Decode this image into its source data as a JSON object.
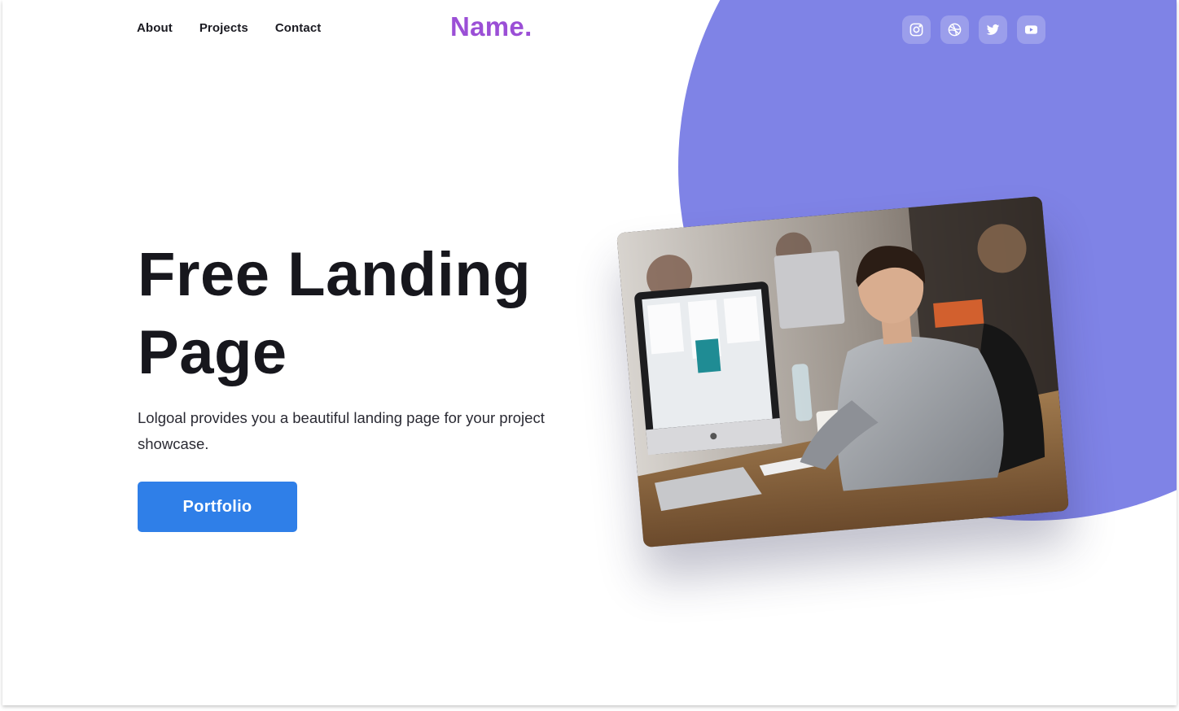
{
  "nav": {
    "items": [
      {
        "label": "About"
      },
      {
        "label": "Projects"
      },
      {
        "label": "Contact"
      }
    ]
  },
  "brand": {
    "name": "Name."
  },
  "social": {
    "icons": [
      "instagram-icon",
      "dribbble-icon",
      "twitter-icon",
      "youtube-icon"
    ]
  },
  "hero": {
    "title": "Free Landing Page",
    "subtitle": "Lolgoal provides you a beautiful landing page for your project showcase.",
    "cta_label": "Portfolio"
  },
  "colors": {
    "blob": "#7f83e6",
    "brand": "#9b4fd6",
    "cta": "#2f7fe8",
    "text": "#17171d"
  }
}
